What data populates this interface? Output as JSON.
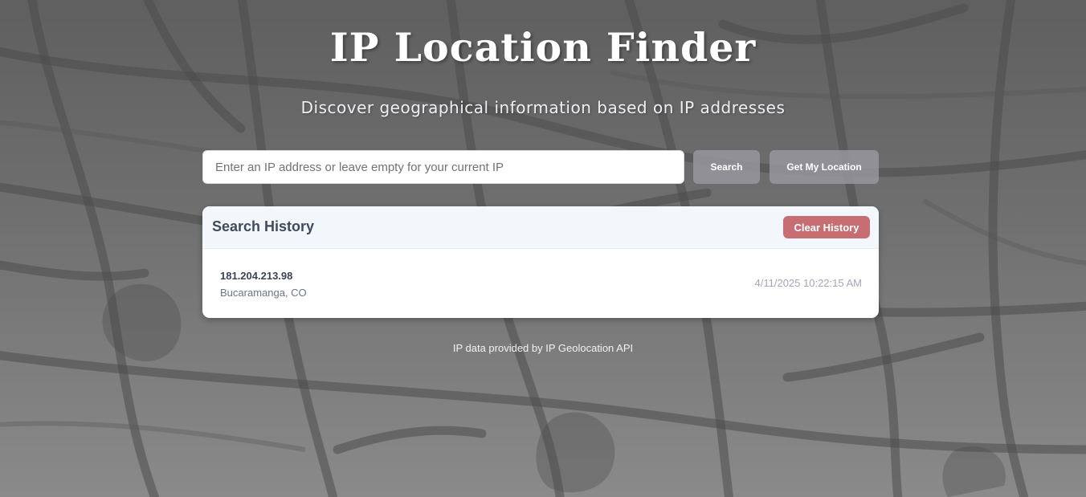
{
  "header": {
    "title": "IP Location Finder",
    "subtitle": "Discover geographical information based on IP addresses"
  },
  "search": {
    "placeholder": "Enter an IP address or leave empty for your current IP",
    "value": "",
    "search_label": "Search",
    "locate_label": "Get My Location"
  },
  "history": {
    "title": "Search History",
    "clear_label": "Clear History",
    "items": [
      {
        "ip": "181.204.213.98",
        "location": "Bucaramanga, CO",
        "timestamp": "4/11/2025 10:22:15 AM"
      }
    ]
  },
  "footer": {
    "text": "IP data provided by IP Geolocation API"
  },
  "colors": {
    "background": "#6e6e6e",
    "clear_button": "#c86e72",
    "action_button": "#96969e",
    "card": "#ffffff",
    "card_header": "#f3f7fb"
  },
  "icons": {
    "background": "street-map-pattern"
  }
}
